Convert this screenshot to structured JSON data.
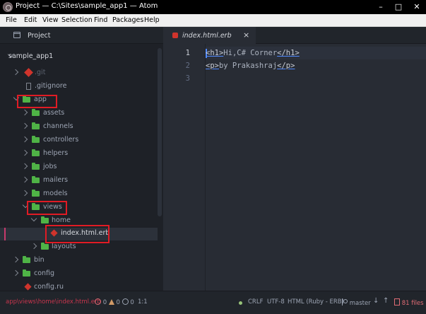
{
  "window": {
    "title": "Project — C:\\Sites\\sample_app1 — Atom",
    "minimize": "–",
    "maximize": "□",
    "close": "✕"
  },
  "menu": [
    "File",
    "Edit",
    "View",
    "Selection",
    "Find",
    "Packages",
    "Help"
  ],
  "tree": {
    "tab_label": "Project",
    "root": "sample_app1",
    "items": {
      "git": ".git",
      "gitignore": ".gitignore",
      "app": "app",
      "assets": "assets",
      "channels": "channels",
      "controllers": "controllers",
      "helpers": "helpers",
      "jobs": "jobs",
      "mailers": "mailers",
      "models": "models",
      "views": "views",
      "home": "home",
      "index": "index.html.erb",
      "layouts": "layouts",
      "bin": "bin",
      "config": "config",
      "config_ru": "config.ru"
    }
  },
  "editor": {
    "tab_label": "index.html.erb",
    "tab_close": "×",
    "line_numbers": [
      "1",
      "2",
      "3"
    ],
    "lines": [
      {
        "open": "<h1>",
        "text": "Hi,C# Corner",
        "close": "</h1>"
      },
      {
        "open": "<p>",
        "text": "by Prakashraj",
        "close": "</p>"
      }
    ]
  },
  "status": {
    "path": "app\\views\\home\\index.html.erb",
    "errors": "0",
    "warnings": "0",
    "infos": "0",
    "cursor": "1:1",
    "line_ending": "CRLF",
    "encoding": "UTF-8",
    "grammar": "HTML (Ruby - ERB)",
    "branch": "master",
    "files": "81 files"
  },
  "colors": {
    "highlight_box": "#e01b24",
    "folder": "#4fb346",
    "ruby": "#d0342c"
  }
}
